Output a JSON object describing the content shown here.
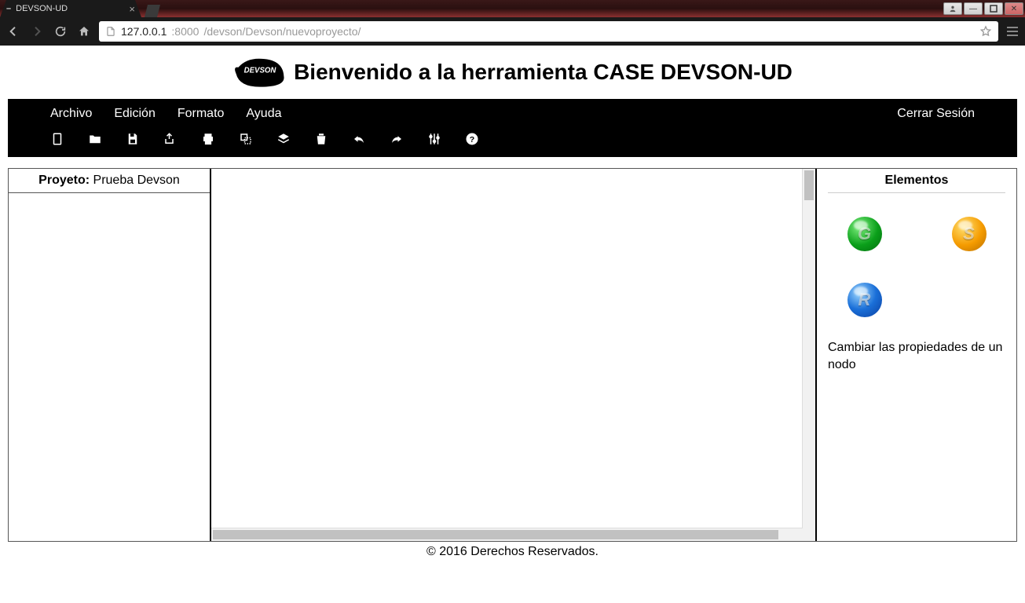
{
  "browser": {
    "tab_title": "DEVSON-UD",
    "url_host": "127.0.0.1",
    "url_port": ":8000",
    "url_path": "/devson/Devson/nuevoproyecto/"
  },
  "header": {
    "logo_text": "DEVSON",
    "title": "Bienvenido a la herramienta CASE DEVSON-UD"
  },
  "menu": {
    "items": [
      "Archivo",
      "Edición",
      "Formato",
      "Ayuda"
    ],
    "logout": "Cerrar Sesión"
  },
  "toolbar_icons": [
    "file-new",
    "folder-open",
    "save",
    "share",
    "print",
    "copy-special",
    "layers",
    "delete",
    "undo",
    "redo",
    "settings-sliders",
    "help"
  ],
  "left_panel": {
    "project_label": "Proyeto:",
    "project_name": "Prueba Devson"
  },
  "right_panel": {
    "title": "Elementos",
    "orbs": [
      {
        "name": "element-green",
        "letter": "G",
        "class": "orb-green"
      },
      {
        "name": "element-orange",
        "letter": "S",
        "class": "orb-orange"
      },
      {
        "name": "element-blue",
        "letter": "R",
        "class": "orb-blue"
      }
    ],
    "hint": "Cambiar las propiedades de un nodo"
  },
  "footer": "© 2016 Derechos Reservados."
}
